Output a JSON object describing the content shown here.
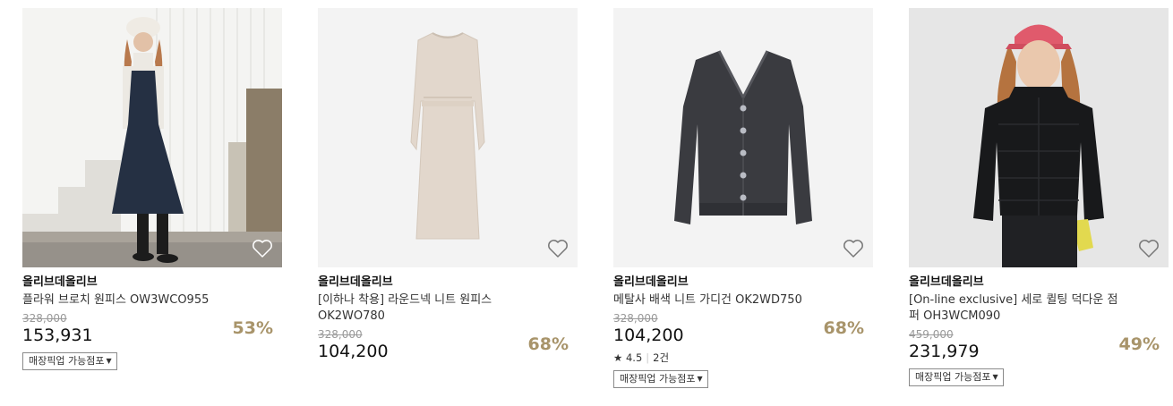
{
  "products": [
    {
      "brand": "올리브데올리브",
      "name": "플라워 브로치 원피스 OW3WCO955",
      "original_price": "328,000",
      "price": "153,931",
      "discount": "53%",
      "pickup_label": "매장픽업 가능점포"
    },
    {
      "brand": "올리브데올리브",
      "name": "[이하나 착용] 라운드넥 니트 원피스 OK2WO780",
      "original_price": "328,000",
      "price": "104,200",
      "discount": "68%"
    },
    {
      "brand": "올리브데올리브",
      "name": "메탈사 배색 니트 가디건 OK2WD750",
      "original_price": "328,000",
      "price": "104,200",
      "discount": "68%",
      "rating": "4.5",
      "review_count": "2건",
      "pickup_label": "매장픽업 가능점포"
    },
    {
      "brand": "올리브데올리브",
      "name": "[On-line exclusive] 세로 퀼팅 덕다운 점퍼 OH3WCM090",
      "original_price": "459,000",
      "price": "231,979",
      "discount": "49%",
      "pickup_label": "매장픽업 가능점포"
    }
  ],
  "icons": {
    "wishlist": "heart-outline-icon",
    "rating": "star-icon",
    "dropdown": "caret-down-icon"
  },
  "colors": {
    "discount": "#a8946a",
    "original_price": "#999999"
  }
}
